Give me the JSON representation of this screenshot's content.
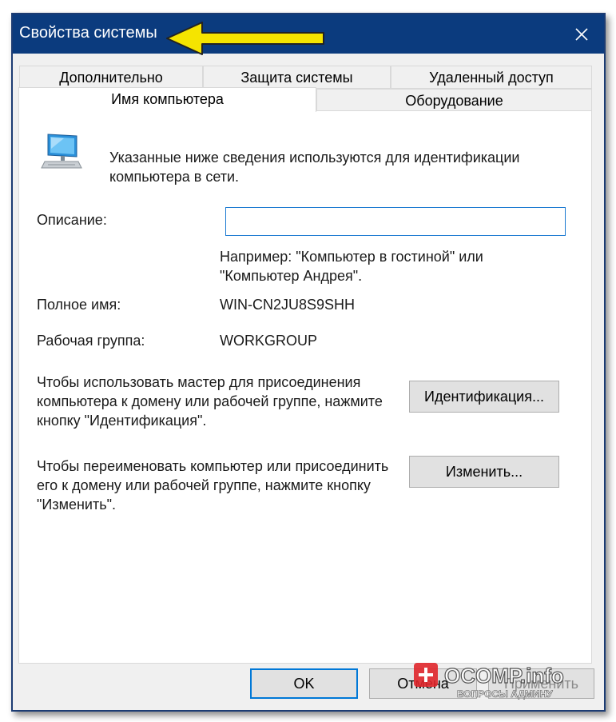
{
  "window": {
    "title": "Свойства системы",
    "close_symbol": "✕"
  },
  "tabs": {
    "row_back": [
      "Дополнительно",
      "Защита системы",
      "Удаленный доступ"
    ],
    "row_front": [
      "Имя компьютера",
      "Оборудование"
    ],
    "active": "Имя компьютера"
  },
  "panel": {
    "intro": "Указанные ниже сведения используются для идентификации компьютера в сети.",
    "description_label": "Описание:",
    "description_value": "",
    "example_text": "Например: \"Компьютер в гостиной\" или \"Компьютер Андрея\".",
    "full_name_label": "Полное имя:",
    "full_name_value": "WIN-CN2JU8S9SHH",
    "workgroup_label": "Рабочая группа:",
    "workgroup_value": "WORKGROUP",
    "network_id_text": "Чтобы использовать мастер для присоединения компьютера к домену или рабочей группе, нажмите кнопку \"Идентификация\".",
    "network_id_button": "Идентификация...",
    "rename_text": "Чтобы переименовать компьютер или присоединить его к домену или рабочей группе, нажмите кнопку \"Изменить\".",
    "rename_button": "Изменить..."
  },
  "footer": {
    "ok_button": "OK",
    "cancel_button": "Отмена",
    "apply_button": "Применить"
  },
  "watermark": {
    "brand": "OCOMP.info",
    "tagline": "ВОПРОСЫ АДМИНУ"
  },
  "icons": {
    "computer": "computer-monitor-icon",
    "close": "close-icon",
    "annotation": "yellow-arrow"
  },
  "colors": {
    "titlebar": "#0b3b7e",
    "accent": "#0078d7",
    "arrow": "#f5e400"
  }
}
